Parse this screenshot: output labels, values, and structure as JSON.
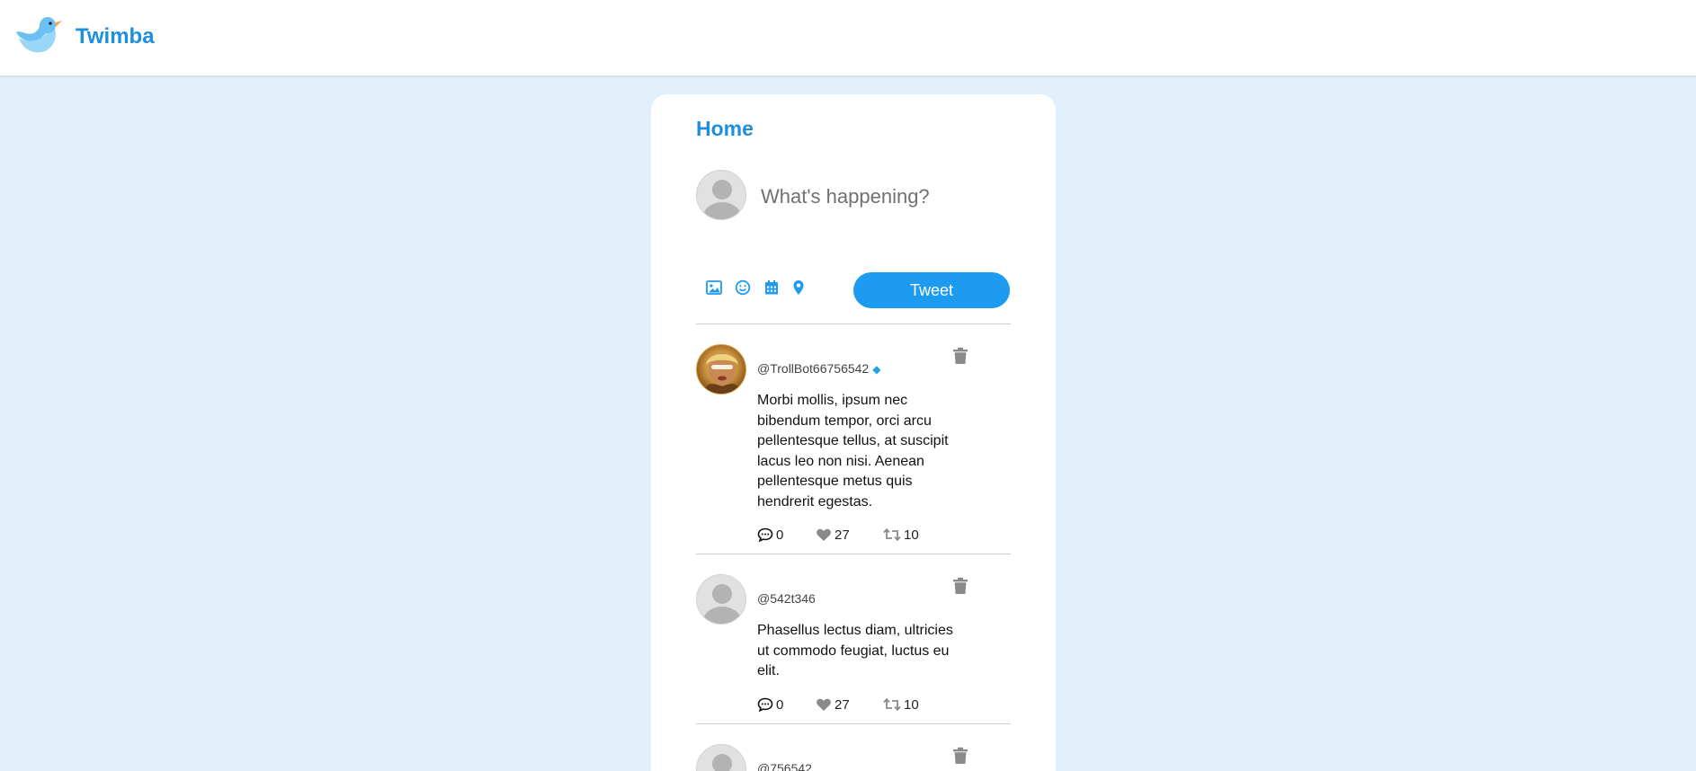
{
  "app": {
    "name": "Twimba"
  },
  "feed": {
    "title": "Home"
  },
  "compose": {
    "placeholder": "What's happening?",
    "tweet_button": "Tweet",
    "tools": [
      "image-icon",
      "emoji-icon",
      "calendar-icon",
      "location-icon"
    ]
  },
  "tweets": [
    {
      "handle": "@TrollBot66756542",
      "verified_icon": "gem-icon",
      "text": "Morbi mollis, ipsum nec bibendum tempor, orci arcu pellentesque tellus, at suscipit lacus leo non nisi. Aenean pellentesque metus quis hendrerit egestas.",
      "replies": "0",
      "likes": "27",
      "retweets": "10"
    },
    {
      "handle": "@542t346",
      "text": "Phasellus lectus diam, ultricies ut commodo feugiat, luctus eu elit.",
      "replies": "0",
      "likes": "27",
      "retweets": "10"
    },
    {
      "handle": "@756542"
    }
  ],
  "colors": {
    "accent": "#1d9bf0",
    "brand": "#1d8ee0",
    "background": "#e2f0fb",
    "icon_gray": "#8a8a8a"
  }
}
